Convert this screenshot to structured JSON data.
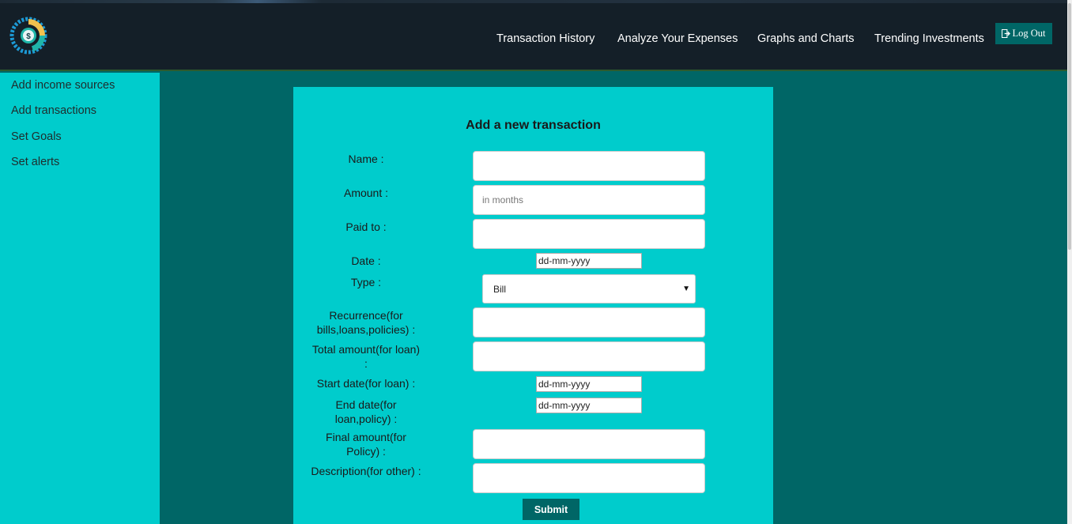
{
  "header": {
    "nav": [
      {
        "label": "Transaction History"
      },
      {
        "label": "Analyze Your Expenses"
      },
      {
        "label": "Graphs and Charts"
      },
      {
        "label": "Trending Investments"
      }
    ],
    "logout_label": "Log Out"
  },
  "sidebar": {
    "items": [
      {
        "label": "Add income sources"
      },
      {
        "label": "Add transactions"
      },
      {
        "label": "Set Goals"
      },
      {
        "label": "Set alerts"
      }
    ]
  },
  "form": {
    "title": "Add a new transaction",
    "name": {
      "label": "Name :",
      "value": ""
    },
    "amount": {
      "label": "Amount :",
      "placeholder": "in months",
      "value": ""
    },
    "paid_to": {
      "label": "Paid to :",
      "value": ""
    },
    "date": {
      "label": "Date :",
      "value": "dd-mm-yyyy"
    },
    "type": {
      "label": "Type :",
      "selected": "Bill"
    },
    "recurrence": {
      "label": "Recurrence(for bills,loans,policies) :",
      "value": ""
    },
    "total_amount": {
      "label": "Total amount(for loan) :",
      "value": ""
    },
    "start_date": {
      "label": "Start date(for loan) :",
      "value": "dd-mm-yyyy"
    },
    "end_date": {
      "label": "End date(for loan,policy) :",
      "value": "dd-mm-yyyy"
    },
    "final_amount": {
      "label": "Final amount(for Policy) :",
      "value": ""
    },
    "description": {
      "label": "Description(for other) :",
      "value": ""
    },
    "submit_label": "Submit"
  },
  "colors": {
    "header_bg": "#141f28",
    "page_bg": "#006666",
    "sidebar_bg": "#00cccc",
    "panel_bg": "#00cccc",
    "button_bg": "#006666"
  }
}
